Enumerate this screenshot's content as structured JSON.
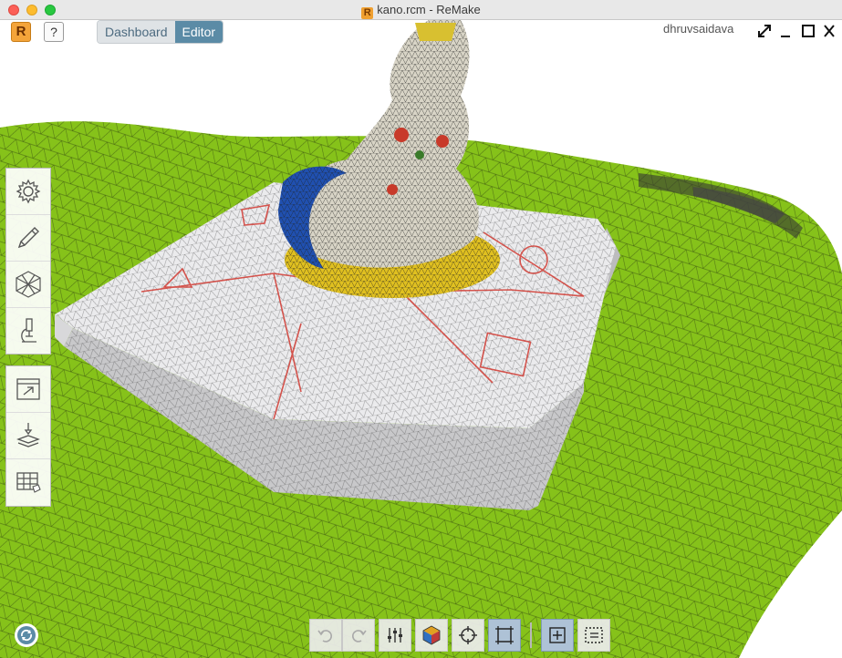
{
  "window": {
    "title": "kano.rcm - ReMake",
    "logo_letter": "R"
  },
  "header": {
    "logo_letter": "R",
    "help_label": "?",
    "modes": [
      {
        "label": "Dashboard"
      },
      {
        "label": "Editor"
      }
    ],
    "active_mode": "Editor",
    "username": "dhruvsaidava"
  },
  "colors": {
    "accent": "#5b8ba6",
    "terrain": "#86c21a",
    "mesh_wire": "#2a3a10",
    "pedestal": "#e8e8ea",
    "statue_yellow": "#e0c020",
    "statue_blue": "#2050b0"
  },
  "left_toolbar": {
    "group1": [
      {
        "icon": "settings-gear-icon"
      },
      {
        "icon": "pencil-icon"
      },
      {
        "icon": "mesh-hexagon-icon"
      },
      {
        "icon": "microscope-icon"
      }
    ],
    "group2": [
      {
        "icon": "export-window-icon"
      },
      {
        "icon": "3d-print-icon"
      },
      {
        "icon": "grid-table-icon"
      }
    ]
  },
  "bottom_toolbar": {
    "items": [
      {
        "icon": "undo-icon",
        "active": false
      },
      {
        "icon": "redo-icon",
        "active": false
      },
      {
        "icon": "sliders-icon",
        "active": false
      },
      {
        "icon": "shaded-cube-icon",
        "active": false
      },
      {
        "icon": "crosshair-icon",
        "active": false
      },
      {
        "icon": "frame-icon",
        "active": true
      },
      {
        "icon": "select-add-icon",
        "active": true
      },
      {
        "icon": "select-box-icon",
        "active": false
      }
    ]
  }
}
